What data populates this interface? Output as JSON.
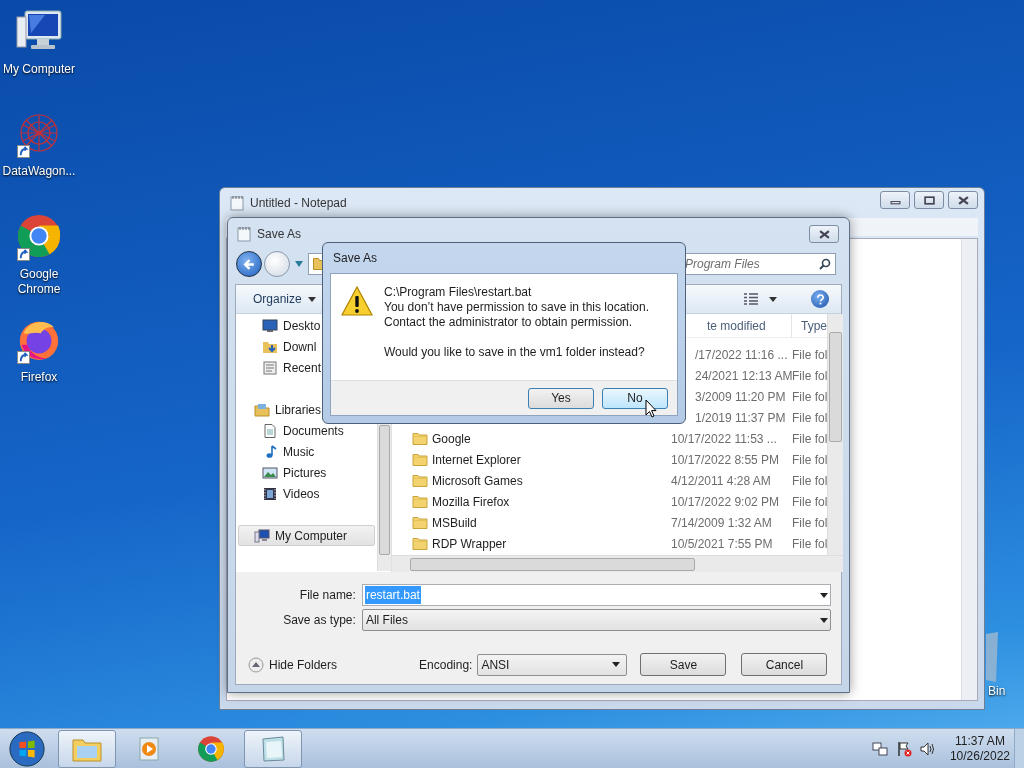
{
  "desktop_icons": [
    {
      "label": "My Computer",
      "kind": "computer",
      "shortcut": false
    },
    {
      "label": "DataWagon...",
      "kind": "datawagon",
      "shortcut": true
    },
    {
      "label": "Google Chrome",
      "kind": "chrome",
      "shortcut": true
    },
    {
      "label": "Firefox",
      "kind": "firefox",
      "shortcut": true
    }
  ],
  "recycle_bin": {
    "label": "Bin"
  },
  "notepad": {
    "title": "Untitled - Notepad"
  },
  "save_dialog": {
    "title": "Save As",
    "search_placeholder": "Program Files",
    "organize": "Organize",
    "nav": [
      {
        "children": [
          {
            "label": "Deskto",
            "kind": "desktop",
            "selected": false
          },
          {
            "label": "Downl",
            "kind": "downloads",
            "selected": false
          },
          {
            "label": "Recent",
            "kind": "recent",
            "selected": false
          }
        ]
      },
      {
        "label": "Libraries",
        "kind": "libraries",
        "selected": false,
        "children": [
          {
            "label": "Documents",
            "kind": "documents",
            "selected": false
          },
          {
            "label": "Music",
            "kind": "music",
            "selected": false
          },
          {
            "label": "Pictures",
            "kind": "pictures",
            "selected": false
          },
          {
            "label": "Videos",
            "kind": "videos",
            "selected": false
          }
        ]
      },
      {
        "label": "My Computer",
        "kind": "computer",
        "selected": true
      }
    ],
    "columns": [
      "te modified",
      "Type"
    ],
    "rows": [
      {
        "date": "/17/2022 11:16 ...",
        "type": "File fol"
      },
      {
        "date": "24/2021 12:13 AM",
        "type": "File fol"
      },
      {
        "date": "3/2009 11:20 PM",
        "type": "File fol"
      },
      {
        "date": "1/2019 11:37 PM",
        "type": "File fol"
      },
      {
        "name": "Google",
        "date": "10/17/2022 11:53 ...",
        "type": "File fol"
      },
      {
        "name": "Internet Explorer",
        "date": "10/17/2022 8:55 PM",
        "type": "File fol"
      },
      {
        "name": "Microsoft Games",
        "date": "4/12/2011 4:28 AM",
        "type": "File fol"
      },
      {
        "name": "Mozilla Firefox",
        "date": "10/17/2022 9:02 PM",
        "type": "File fol"
      },
      {
        "name": "MSBuild",
        "date": "7/14/2009 1:32 AM",
        "type": "File fol"
      },
      {
        "name": "RDP Wrapper",
        "date": "10/5/2021 7:55 PM",
        "type": "File fol"
      }
    ],
    "file_name_label": "File name:",
    "file_name": "restart.bat",
    "save_type_label": "Save as type:",
    "save_type": "All Files",
    "hide_folders": "Hide Folders",
    "encoding_label": "Encoding:",
    "encoding": "ANSI",
    "buttons": [
      "Save",
      "Cancel"
    ]
  },
  "message_box": {
    "title": "Save As",
    "lines": [
      "C:\\Program Files\\restart.bat",
      "You don’t have permission to save in this location.",
      "Contact the administrator to obtain permission."
    ],
    "question": "Would you like to save in the vm1 folder instead?",
    "buttons": [
      {
        "label": "Yes",
        "focused": false
      },
      {
        "label": "No",
        "focused": true
      }
    ]
  },
  "taskbar": {
    "apps": [
      {
        "kind": "explorer",
        "active": true
      },
      {
        "kind": "media",
        "active": false
      },
      {
        "kind": "chrome",
        "active": false
      },
      {
        "kind": "notepad",
        "active": true
      }
    ],
    "time": "11:37 AM",
    "date": "10/26/2022"
  }
}
